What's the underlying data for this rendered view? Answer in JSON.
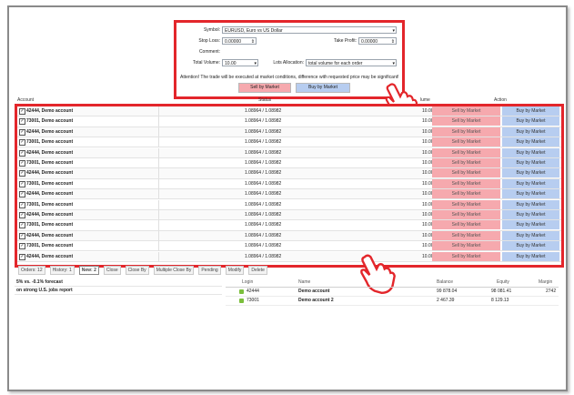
{
  "order_panel": {
    "symbol_label": "Symbol:",
    "symbol_value": "EURUSD,  Euro vs US Dollar",
    "stop_loss_label": "Stop Loss:",
    "stop_loss_value": "0.00000",
    "take_profit_label": "Take Profit:",
    "take_profit_value": "0.00000",
    "comment_label": "Comment:",
    "total_volume_label": "Total Volume:",
    "total_volume_value": "10.00",
    "lots_allocation_label": "Lots Allocation:",
    "lots_allocation_value": "total volume for each order",
    "warning_bold": "Attention! The trade will be executed at market conditions, difference with requested price may be significant!",
    "sell_label": "Sell by Market",
    "buy_label": "Buy by Market"
  },
  "table_header": {
    "account": "Account",
    "status": "Status",
    "volume": "lume",
    "action": "Action"
  },
  "rows": [
    {
      "account": "42444, Demo account",
      "status": "1.08964 / 1.08982",
      "volume": "10.00",
      "sell": "Sell by Market",
      "buy": "Buy by Market"
    },
    {
      "account": "73001, Demo account",
      "status": "1.08964 / 1.08982",
      "volume": "10.00",
      "sell": "Sell by Market",
      "buy": "Buy by Market"
    },
    {
      "account": "42444, Demo account",
      "status": "1.08964 / 1.08982",
      "volume": "10.00",
      "sell": "Sell by Market",
      "buy": "Buy by Market"
    },
    {
      "account": "73001, Demo account",
      "status": "1.08964 / 1.08982",
      "volume": "10.00",
      "sell": "Sell by Market",
      "buy": "Buy by Market"
    },
    {
      "account": "42444, Demo account",
      "status": "1.08964 / 1.08982",
      "volume": "10.00",
      "sell": "Sell by Market",
      "buy": "Buy by Market"
    },
    {
      "account": "73001, Demo account",
      "status": "1.08964 / 1.08982",
      "volume": "10.00",
      "sell": "Sell by Market",
      "buy": "Buy by Market"
    },
    {
      "account": "42444, Demo account",
      "status": "1.08964 / 1.08982",
      "volume": "10.00",
      "sell": "Sell by Market",
      "buy": "Buy by Market"
    },
    {
      "account": "73001, Demo account",
      "status": "1.08964 / 1.08982",
      "volume": "10.00",
      "sell": "Sell by Market",
      "buy": "Buy by Market"
    },
    {
      "account": "42444, Demo account",
      "status": "1.08964 / 1.08982",
      "volume": "10.00",
      "sell": "Sell by Market",
      "buy": "Buy by Market"
    },
    {
      "account": "73001, Demo account",
      "status": "1.08964 / 1.08982",
      "volume": "10.00",
      "sell": "Sell by Market",
      "buy": "Buy by Market"
    },
    {
      "account": "42444, Demo account",
      "status": "1.08964 / 1.08982",
      "volume": "10.00",
      "sell": "Sell by Market",
      "buy": "Buy by Market"
    },
    {
      "account": "73001, Demo account",
      "status": "1.08964 / 1.08982",
      "volume": "10.00",
      "sell": "Sell by Market",
      "buy": "Buy by Market"
    },
    {
      "account": "42444, Demo account",
      "status": "1.08964 / 1.08982",
      "volume": "10.00",
      "sell": "Sell by Market",
      "buy": "Buy by Market"
    },
    {
      "account": "73001, Demo account",
      "status": "1.08964 / 1.08982",
      "volume": "10.00",
      "sell": "Sell by Market",
      "buy": "Buy by Market"
    },
    {
      "account": "42444, Demo account",
      "status": "1.08964 / 1.08982",
      "volume": "10.00",
      "sell": "Sell by Market",
      "buy": "Buy by Market"
    }
  ],
  "bottom_tabs": [
    "Orders: 12",
    "History: 1",
    "New: 2",
    "Close",
    "Close By",
    "Multiple Close By",
    "Pending",
    "Modify",
    "Delete"
  ],
  "news": [
    "5% vs. -0.1% forecast",
    "on strong U.S. jobs report"
  ],
  "accounts_header": {
    "login": "Login",
    "name": "Name",
    "balance": "Balance",
    "equity": "Equity",
    "margin": "Margin"
  },
  "accounts": [
    {
      "login": "42444",
      "name": "Demo account",
      "balance": "99 878.04",
      "equity": "98 081.41",
      "margin": "2742"
    },
    {
      "login": "73001",
      "name": "Demo account 2",
      "balance": "2 467.39",
      "equity": "8 129.13",
      "margin": ""
    }
  ],
  "colors": {
    "highlight_border": "#e3262b",
    "sell": "#f6a9ae",
    "buy": "#b7cdf0"
  }
}
